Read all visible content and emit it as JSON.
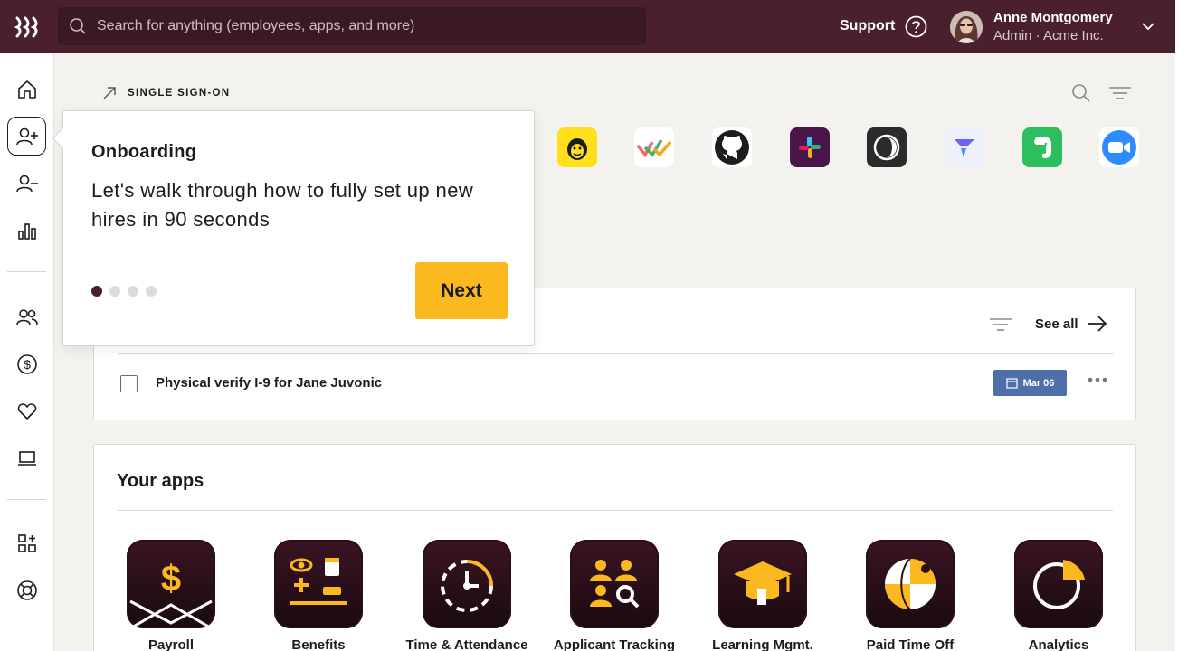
{
  "topbar": {
    "search_placeholder": "Search for anything (employees, apps, and more)",
    "support_label": "Support",
    "user_name": "Anne Montgomery",
    "user_role": "Admin · Acme Inc."
  },
  "sidebar": {
    "items": [
      "home-icon",
      "onboarding-icon",
      "offboarding-icon",
      "reports-icon",
      "people-icon",
      "payroll-icon",
      "benefits-icon",
      "devices-icon",
      "add-apps-icon",
      "help-icon"
    ]
  },
  "sso": {
    "title": "SINGLE SIGN-ON",
    "apps": [
      "mailchimp-icon",
      "asana-icon",
      "github-icon",
      "slack-icon",
      "cloud-icon",
      "linear-icon",
      "evernote-icon",
      "zoom-icon"
    ]
  },
  "tasks": {
    "see_all_label": "See all",
    "items": [
      {
        "text": "Physical verify I-9 for Jane Juvonic",
        "date": "Mar 06"
      }
    ]
  },
  "apps": {
    "title": "Your apps",
    "items": [
      {
        "label": "Payroll",
        "icon": "payroll-app-icon"
      },
      {
        "label": "Benefits",
        "icon": "benefits-app-icon"
      },
      {
        "label": "Time & Attendance",
        "icon": "time-app-icon"
      },
      {
        "label": "Applicant Tracking",
        "icon": "applicant-app-icon"
      },
      {
        "label": "Learning Mgmt.",
        "icon": "learning-app-icon"
      },
      {
        "label": "Paid Time Off",
        "icon": "pto-app-icon"
      },
      {
        "label": "Analytics",
        "icon": "analytics-app-icon"
      }
    ]
  },
  "popover": {
    "title": "Onboarding",
    "body": "Let's walk through how to fully set up new hires in 90 seconds",
    "next_label": "Next",
    "step_total": 4,
    "step_current": 1
  },
  "colors": {
    "brand": "#4a1f2e",
    "accent": "#fbb81f",
    "badge": "#4e6fa8"
  }
}
